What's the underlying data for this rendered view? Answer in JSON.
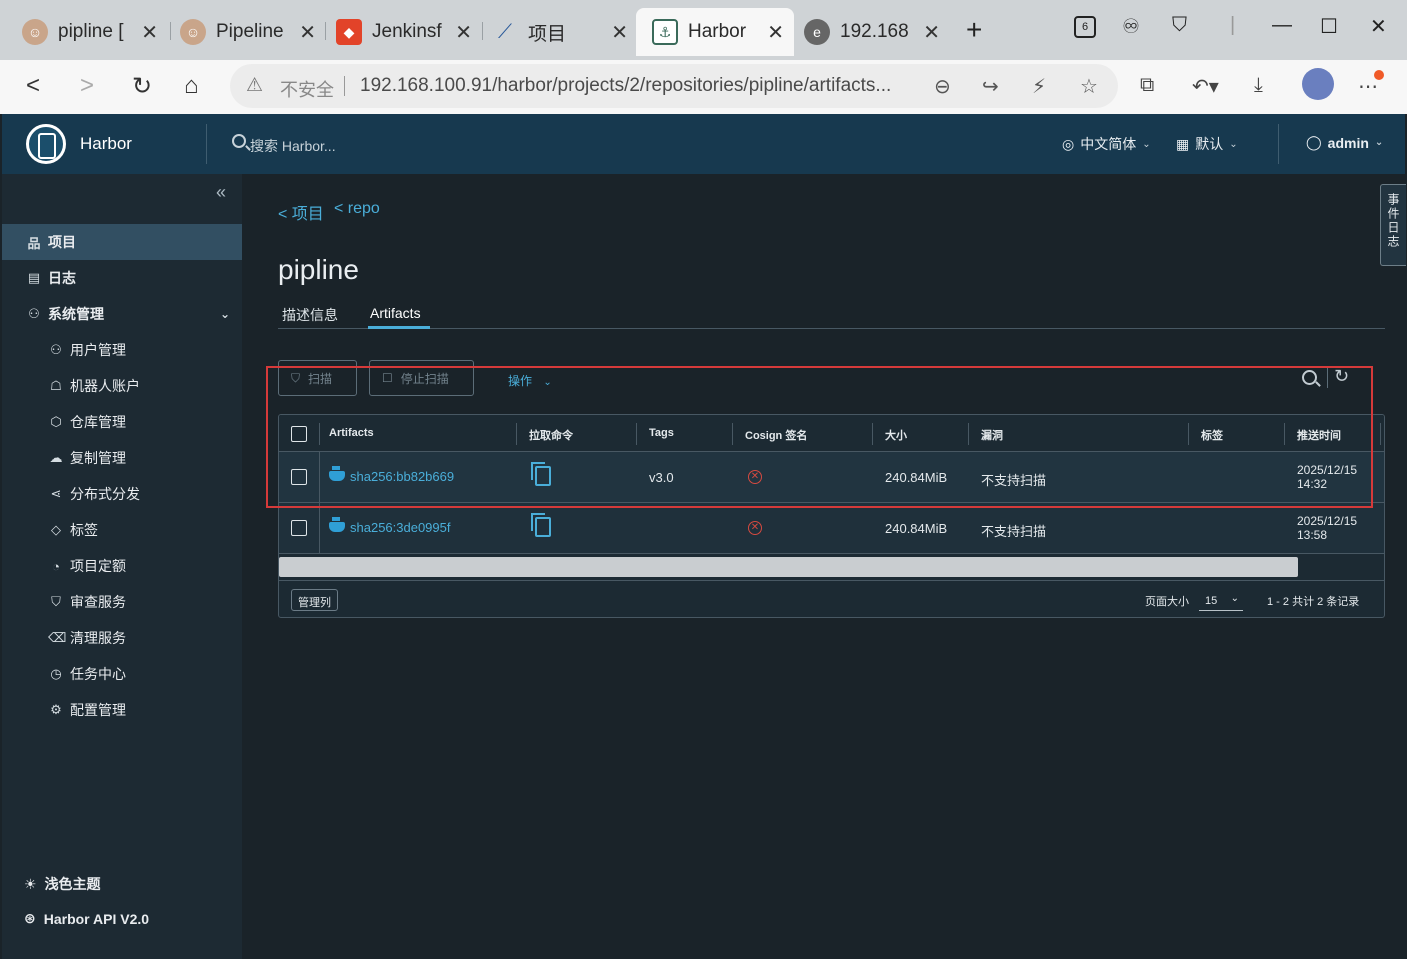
{
  "browser": {
    "tabs": [
      {
        "title": "pipline [",
        "favicon": "jenkins-icon"
      },
      {
        "title": "Pipeline",
        "favicon": "jenkins-icon"
      },
      {
        "title": "Jenkinsf",
        "favicon": "gitlab-icon"
      },
      {
        "title": "项目",
        "favicon": "harbor-icon"
      },
      {
        "title": "Harbor",
        "favicon": "harbor-icon"
      },
      {
        "title": "192.168",
        "favicon": "edge-icon"
      }
    ],
    "tab_count_badge": "6",
    "security_label": "不安全",
    "url": "192.168.100.91/harbor/projects/2/repositories/pipline/artifacts..."
  },
  "harbor": {
    "brand": "Harbor",
    "search_placeholder": "搜索 Harbor...",
    "language": "中文简体",
    "theme_default": "默认",
    "user": "admin"
  },
  "sidebar": {
    "items": [
      {
        "label": "项目",
        "icon": "projects-icon",
        "active": true
      },
      {
        "label": "日志",
        "icon": "log-icon"
      },
      {
        "label": "系统管理",
        "icon": "admin-icon"
      },
      {
        "label": "用户管理",
        "icon": "users-icon"
      },
      {
        "label": "机器人账户",
        "icon": "robot-icon"
      },
      {
        "label": "仓库管理",
        "icon": "registry-icon"
      },
      {
        "label": "复制管理",
        "icon": "replication-icon"
      },
      {
        "label": "分布式分发",
        "icon": "share-icon"
      },
      {
        "label": "标签",
        "icon": "tag-icon"
      },
      {
        "label": "项目定额",
        "icon": "quota-icon"
      },
      {
        "label": "审查服务",
        "icon": "shield-icon"
      },
      {
        "label": "清理服务",
        "icon": "trash-icon"
      },
      {
        "label": "任务中心",
        "icon": "task-icon"
      },
      {
        "label": "配置管理",
        "icon": "gear-icon"
      }
    ],
    "theme_toggle": "浅色主题",
    "api_link": "Harbor API V2.0"
  },
  "main": {
    "breadcrumbs": [
      "< 项目",
      "< repo"
    ],
    "title": "pipline",
    "tabs": [
      "描述信息",
      "Artifacts"
    ],
    "active_tab": "Artifacts",
    "toolbar": {
      "scan": "扫描",
      "stop_scan": "停止扫描",
      "actions": "操作"
    },
    "table": {
      "columns": [
        "Artifacts",
        "拉取命令",
        "Tags",
        "Cosign 签名",
        "大小",
        "漏洞",
        "标签",
        "推送时间"
      ],
      "rows": [
        {
          "digest": "sha256:bb82b669",
          "tags": "v3.0",
          "size": "240.84MiB",
          "vuln": "不支持扫描",
          "labels": "",
          "time_date": "2025/12/15",
          "time_clock": "14:32"
        },
        {
          "digest": "sha256:3de0995f",
          "tags": "",
          "size": "240.84MiB",
          "vuln": "不支持扫描",
          "labels": "",
          "time_date": "2025/12/15",
          "time_clock": "13:58"
        }
      ],
      "manage_columns": "管理列",
      "page_size_label": "页面大小",
      "page_size": "15",
      "pagination": "1 - 2 共计 2 条记录"
    },
    "event_panel": "事件日志"
  },
  "colors": {
    "accent": "#4aaed9",
    "highlight": "#d63a3a",
    "header": "#17394f"
  }
}
